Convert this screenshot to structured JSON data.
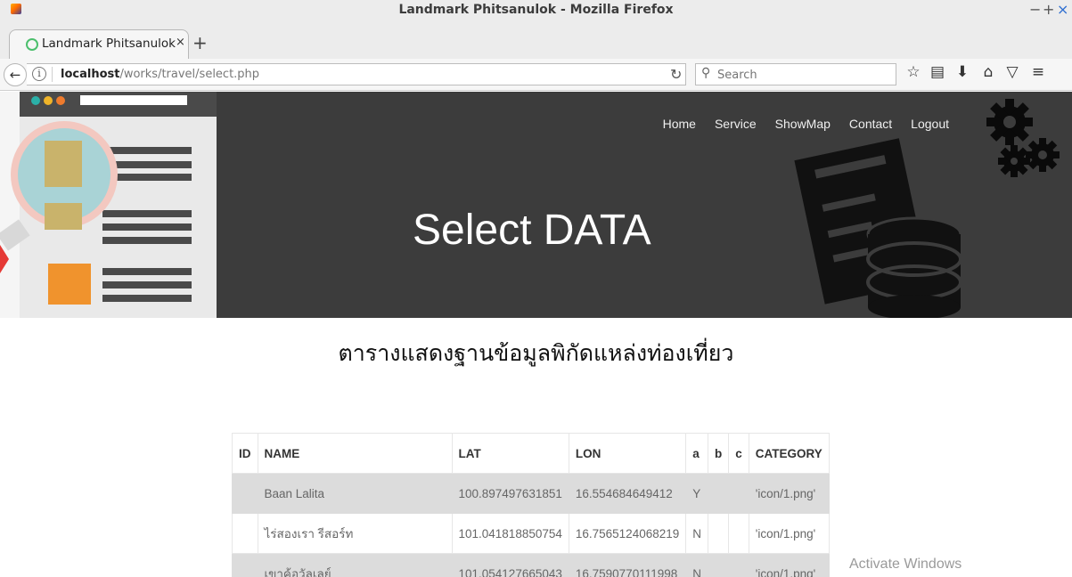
{
  "window": {
    "title": "Landmark Phitsanulok - Mozilla Firefox",
    "controls": [
      "−",
      "+",
      "×"
    ]
  },
  "tab": {
    "label": "Landmark Phitsanulok",
    "close": "×",
    "new_tab": "+"
  },
  "navbar": {
    "url_host": "localhost",
    "url_path": "/works/travel/select.php",
    "search_placeholder": "Search"
  },
  "site": {
    "nav": [
      "Home",
      "Service",
      "ShowMap",
      "Contact",
      "Logout"
    ],
    "hero_title": "Select DATA",
    "heading": "ตารางแสดงฐานข้อมูลพิกัดแหล่งท่องเที่ยว"
  },
  "table": {
    "headers": [
      "ID",
      "NAME",
      "LAT",
      "LON",
      "a",
      "b",
      "c",
      "CATEGORY"
    ],
    "rows": [
      [
        "",
        "Baan Lalita",
        "100.897497631851",
        "16.554684649412",
        "Y",
        "",
        "",
        "'icon/1.png'"
      ],
      [
        "",
        "ไร่สองเรา รีสอร์ท",
        "101.041818850754",
        "16.7565124068219",
        "N",
        "",
        "",
        "'icon/1.png'"
      ],
      [
        "",
        "เขาค้อวัลเลย์",
        "101.054127665043",
        "16.7590770111998",
        "N",
        "",
        "",
        "'icon/1.png'"
      ]
    ]
  },
  "watermark": "Activate Windows"
}
